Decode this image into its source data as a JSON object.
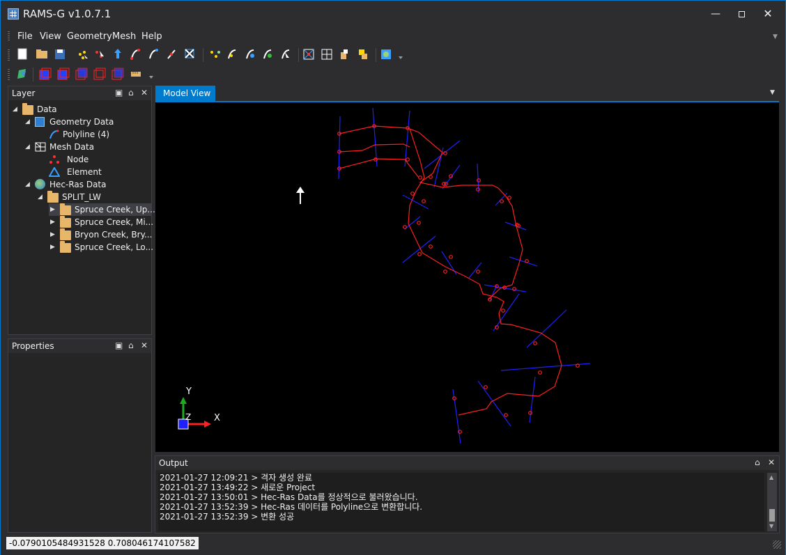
{
  "app": {
    "title": "RAMS-G v1.0.7.1"
  },
  "menu": [
    "File",
    "View",
    "Geometry",
    "Mesh",
    "Help"
  ],
  "layer_panel": {
    "title": "Layer",
    "tree": [
      {
        "label": "Data",
        "icon": "folder-open-icon"
      },
      {
        "label": "Geometry Data",
        "icon": "geometry-icon"
      },
      {
        "label": "Polyline (4)",
        "icon": "polyline-icon"
      },
      {
        "label": "Mesh Data",
        "icon": "mesh-icon"
      },
      {
        "label": "Node",
        "icon": "node-icon"
      },
      {
        "label": "Element",
        "icon": "element-icon"
      },
      {
        "label": "Hec-Ras Data",
        "icon": "globe-icon"
      },
      {
        "label": "SPLIT_LW",
        "icon": "folder-open-icon"
      },
      {
        "label": "Spruce Creek, Up...",
        "icon": "folder-icon"
      },
      {
        "label": "Spruce Creek, Mi...",
        "icon": "folder-icon"
      },
      {
        "label": "Bryon Creek, Bry...",
        "icon": "folder-icon"
      },
      {
        "label": "Spruce Creek, Lo...",
        "icon": "folder-icon"
      }
    ]
  },
  "properties_panel": {
    "title": "Properties"
  },
  "model_view": {
    "tab_label": "Model View",
    "axis_labels": {
      "x": "X",
      "y": "Y",
      "z": "Z"
    }
  },
  "output": {
    "title": "Output",
    "lines": [
      "2021-01-27 12:09:21 > 격자 생성 완료",
      "2021-01-27 13:49:22 > 새로운 Project",
      "2021-01-27 13:50:01 > Hec-Ras Data를 정상적으로 불러왔습니다.",
      "2021-01-27 13:52:39 > Hec-Ras 데이터를 Polyline으로 변환합니다.",
      "2021-01-27 13:52:39 > 변환 성공"
    ]
  },
  "status": {
    "coordinates": "-0.0790105484931528 0.708046174107582"
  },
  "colors": {
    "accent": "#007acc",
    "river_line": "#ff2020",
    "cross_section": "#2020ff"
  }
}
